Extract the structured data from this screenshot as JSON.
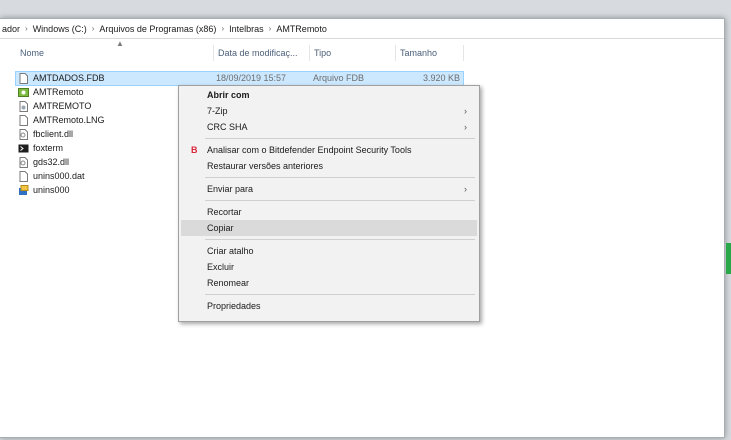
{
  "breadcrumb": [
    "ador",
    "Windows (C:)",
    "Arquivos de Programas (x86)",
    "Intelbras",
    "AMTRemoto"
  ],
  "breadcrumb_separator": "›",
  "columns": {
    "name": "Nome",
    "date": "Data de modificaç...",
    "type": "Tipo",
    "size": "Tamanho"
  },
  "files": [
    {
      "name": "AMTDADOS.FDB",
      "date": "18/09/2019 15:57",
      "type": "Arquivo FDB",
      "size": "3.920 KB",
      "icon": "blank-file-icon",
      "selected": true
    },
    {
      "name": "AMTRemoto",
      "icon": "app-icon"
    },
    {
      "name": "AMTREMOTO",
      "icon": "settings-file-icon"
    },
    {
      "name": "AMTRemoto.LNG",
      "icon": "blank-file-icon"
    },
    {
      "name": "fbclient.dll",
      "icon": "dll-icon"
    },
    {
      "name": "foxterm",
      "icon": "terminal-icon"
    },
    {
      "name": "gds32.dll",
      "icon": "dll-icon"
    },
    {
      "name": "unins000.dat",
      "icon": "blank-file-icon"
    },
    {
      "name": "unins000",
      "icon": "uninstaller-icon"
    }
  ],
  "context_menu": {
    "open_with": "Abrir com",
    "zip": "7-Zip",
    "crc": "CRC SHA",
    "bitdefender": "Analisar com o Bitdefender Endpoint Security Tools",
    "bitdefender_badge": "B",
    "restore": "Restaurar versões anteriores",
    "send_to": "Enviar para",
    "cut": "Recortar",
    "copy": "Copiar",
    "shortcut": "Criar atalho",
    "delete": "Excluir",
    "rename": "Renomear",
    "properties": "Propriedades",
    "submenu_arrow": "›"
  },
  "colors": {
    "selection": "#cce8ff",
    "hover": "#dadada",
    "menu_bg": "#f2f2f2",
    "accent_green": "#29a84a"
  }
}
